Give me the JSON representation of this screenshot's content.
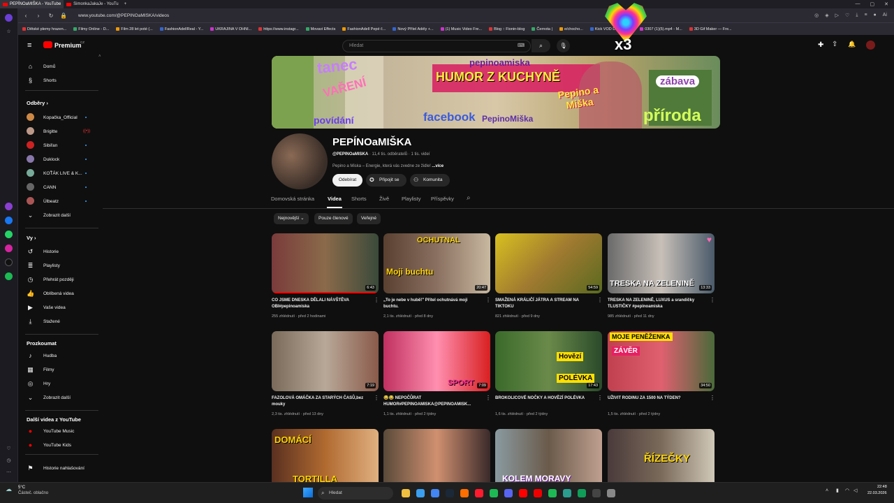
{
  "browser": {
    "tabs": [
      "PEPÍNOaMIŠKA - YouTube",
      "SimonkaJakaJe - YouTu"
    ],
    "url": "www.youtube.com/@PEPINOaMISKA/videos",
    "bookmarks": [
      "Dětské plemy hrazen...",
      "Filmy Online - D...",
      "Film 28 let poté (...",
      "FashionAdellReal - Y...",
      "UKRAJINA V OHNI...",
      "https://www.instagr...",
      "Movavi Effects",
      "FashionAdell Pepé č...",
      "Nový Přítel Adély +...",
      "(1) Music Video Fre...",
      "Blog :: Fionin-blog",
      "Černota |",
      "e/chocho...",
      "Kick VOD Download...",
      "0307 (1)(5).mp4 - M...",
      "3D Gif Maker — Fre..."
    ]
  },
  "yt": {
    "logo": "Premium",
    "region": "CZ",
    "search_placeholder": "Hledat"
  },
  "sidebar": {
    "main": [
      {
        "label": "Domů"
      },
      {
        "label": "Shorts"
      }
    ],
    "subs_header": "Odběry",
    "subs": [
      {
        "label": "Kopačka_Official",
        "badge": "dot"
      },
      {
        "label": "Brigitte",
        "badge": "live"
      },
      {
        "label": "Sibiřan",
        "badge": "dot"
      },
      {
        "label": "Duklock",
        "badge": "dot"
      },
      {
        "label": "KOŤÁK LIVE & K...",
        "badge": "dot"
      },
      {
        "label": "CANN",
        "badge": "dot"
      },
      {
        "label": "Ülbeatz",
        "badge": "dot"
      }
    ],
    "show_more": "Zobrazit další",
    "you_header": "Vy",
    "you": [
      {
        "label": "Historie"
      },
      {
        "label": "Playlisty"
      },
      {
        "label": "Přehrát později"
      },
      {
        "label": "Oblíbená videa"
      },
      {
        "label": "Vaše videa"
      },
      {
        "label": "Stažené"
      }
    ],
    "explore_header": "Prozkoumat",
    "explore": [
      {
        "label": "Hudba"
      },
      {
        "label": "Filmy"
      },
      {
        "label": "Hry"
      },
      {
        "label": "Zobrazit další"
      }
    ],
    "more_header": "Další videa z YouTube",
    "more": [
      {
        "label": "YouTube Music"
      },
      {
        "label": "YouTube Kids"
      }
    ],
    "report": "Historie nahlašování"
  },
  "banner": {
    "texts": [
      "tanec",
      "VAŘENÍ",
      "povídání",
      "pepinoamiska",
      "HUMOR Z KUCHYNĚ",
      "Pepino a Miška",
      "facebook",
      "PepinoMiška",
      "zábava",
      "příroda"
    ]
  },
  "channel": {
    "name": "PEPÍNOaMIŠKA",
    "handle": "@PEPINOaMISKA",
    "subscribers": "11,4 tis. odběratelů",
    "videos_count": "1 tis. videí",
    "description": "Pepino a Miska – Energie, která vás zvedne ze židle!",
    "more": "...více",
    "subscribe": "Odebírat",
    "join": "Připojit se",
    "community": "Komunita"
  },
  "tabs": [
    "Domovská stránka",
    "Videa",
    "Shorts",
    "Živě",
    "Playlisty",
    "Příspěvky"
  ],
  "chips": [
    "Nejnovější",
    "Pouze členové",
    "Veřejné"
  ],
  "videos": [
    {
      "title": "CO JSME DNESKA DĚLALI NÁVŠTĚVA OBI#pepinoamiska",
      "views": "255 zhlédnutí",
      "age": "před 2 hodinami",
      "duration": "6:43",
      "overlay": "",
      "watched": 1.0
    },
    {
      "title": "„To je nebe v hubě!\" Přítel ochutnává moji buchtu.",
      "views": "2,1 tis. zhlédnutí",
      "age": "před 8 dny",
      "duration": "20:47",
      "overlay": "OCHUTNAL Moji buchtu",
      "watched": 0
    },
    {
      "title": "SMAŽENÁ KRÁLIČÍ JÁTRA A STREAM NA TIKTOKU",
      "views": "821 zhlédnutí",
      "age": "před 9 dny",
      "duration": "54:59",
      "overlay": "",
      "watched": 0
    },
    {
      "title": "TRESKA NA ZELENINĚ, LUXUS a srandičky TLUSTIČKY #pepinoamiska",
      "views": "985 zhlédnutí",
      "age": "před 11 dny",
      "duration": "13:33",
      "overlay": "TRESKA NA ZELENINĚ",
      "watched": 0
    },
    {
      "title": "FAZOLOVÁ OMÁČKA ZA STARÝCH ČASŮ,bez mouky",
      "views": "2,3 tis. zhlédnutí",
      "age": "před 13 dny",
      "duration": "7:19",
      "overlay": "",
      "watched": 0
    },
    {
      "title": "😂😂 NEPOČŮRAT HUMOR#PEPINOAMISKA@PEPINOAMISK...",
      "views": "1,1 tis. zhlédnutí",
      "age": "před 2 týdny",
      "duration": "7:09",
      "overlay": "SPORT",
      "watched": 0
    },
    {
      "title": "BROKOLICOVÉ NOČKY A HOVĚZÍ POLÉVKA",
      "views": "1,6 tis. zhlédnutí",
      "age": "před 2 týdny",
      "duration": "17:43",
      "overlay": "Hovězí POLÉVKA",
      "watched": 0
    },
    {
      "title": "UŽIVIT RODINU ZA 1500 NA TÝDEN?",
      "views": "1,5 tis. zhlédnutí",
      "age": "před 2 týdny",
      "duration": "34:50",
      "overlay": "MOJE PENĚŽENKA ZÁVĚR",
      "watched": 0
    },
    {
      "title": "",
      "views": "",
      "age": "",
      "duration": "",
      "overlay": "DOMÁCÍ TORTILLA",
      "watched": 0
    },
    {
      "title": "",
      "views": "",
      "age": "",
      "duration": "",
      "overlay": "",
      "watched": 0
    },
    {
      "title": "",
      "views": "",
      "age": "",
      "duration": "",
      "overlay": "KOLEM MORAVY",
      "watched": 0
    },
    {
      "title": "",
      "views": "",
      "age": "",
      "duration": "",
      "overlay": "ŘÍZEČKY",
      "watched": 0
    }
  ],
  "sticker": {
    "text": "x3"
  },
  "taskbar": {
    "weather_temp": "5°C",
    "weather_desc": "Částeč. oblačno",
    "search": "Hledat",
    "time": "22:48",
    "date": "22.03.2026"
  },
  "colors": {
    "accent": "#ff0000",
    "background": "#0f0f0f",
    "link": "#3ea6ff"
  }
}
